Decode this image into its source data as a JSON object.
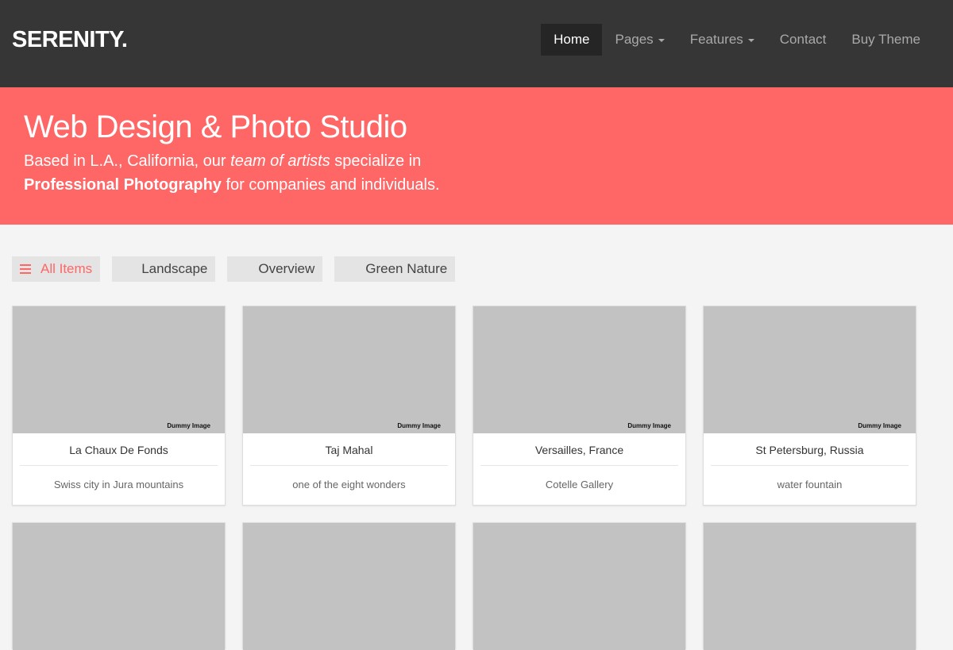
{
  "header": {
    "logo": "SERENITY.",
    "nav": [
      {
        "label": "Home",
        "active": true,
        "dropdown": false
      },
      {
        "label": "Pages",
        "active": false,
        "dropdown": true
      },
      {
        "label": "Features",
        "active": false,
        "dropdown": true
      },
      {
        "label": "Contact",
        "active": false,
        "dropdown": false
      },
      {
        "label": "Buy Theme",
        "active": false,
        "dropdown": false
      }
    ]
  },
  "hero": {
    "title": "Web Design & Photo Studio",
    "line1_prefix": "Based in L.A., California, our ",
    "line1_emphasis": "team of artists",
    "line1_suffix": " specialize in",
    "line2_strong": "Professional Photography",
    "line2_suffix": " for companies and individuals.",
    "background_color": "#ff6666"
  },
  "filters": [
    {
      "label": "All Items",
      "icon": "list-icon",
      "active": true
    },
    {
      "label": "Landscape",
      "icon": "grid-icon",
      "active": false
    },
    {
      "label": "Overview",
      "icon": "th-list-icon",
      "active": false
    },
    {
      "label": "Green Nature",
      "icon": "th-icon",
      "active": false
    }
  ],
  "gallery": {
    "thumbnail_text": "Dummy Image",
    "items": [
      {
        "title": "La Chaux De Fonds",
        "subtitle": "Swiss city in Jura mountains"
      },
      {
        "title": "Taj Mahal",
        "subtitle": "one of the eight wonders"
      },
      {
        "title": "Versailles, France",
        "subtitle": "Cotelle Gallery"
      },
      {
        "title": "St Petersburg, Russia",
        "subtitle": "water fountain"
      }
    ]
  },
  "colors": {
    "header_bg": "#363636",
    "accent": "#ff6666",
    "page_bg": "#f4f4f4",
    "thumbnail_placeholder": "#c2c2c2"
  }
}
